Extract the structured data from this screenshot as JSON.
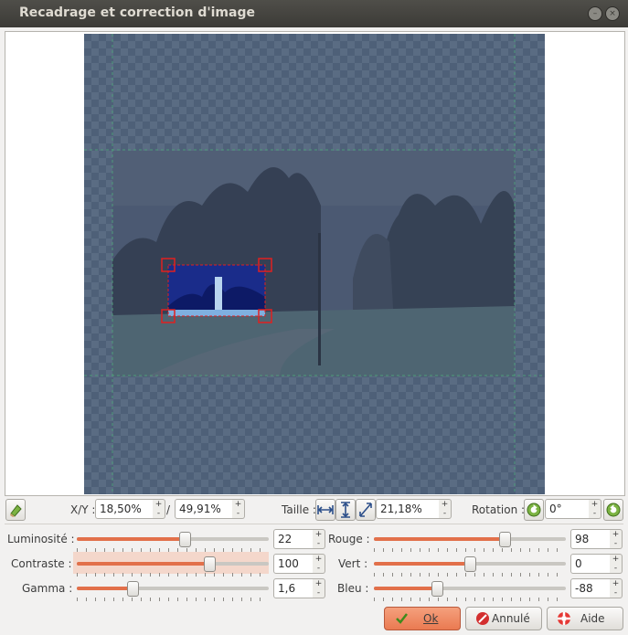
{
  "window": {
    "title": "Recadrage et correction d'image"
  },
  "toolbar": {
    "xy_label": "X/Y :",
    "x_value": "18,50%",
    "separator": "/",
    "y_value": "49,91%",
    "size_label": "Taille :",
    "size_value": "21,18%",
    "rotation_label": "Rotation :",
    "rotation_value": "0°"
  },
  "adjustments": {
    "brightness": {
      "label": "Luminosité :",
      "value": "22",
      "level": 0.56
    },
    "contrast": {
      "label": "Contraste :",
      "value": "100",
      "level": 0.69
    },
    "gamma": {
      "label": "Gamma :",
      "value": "1,6",
      "level": 0.29
    },
    "red": {
      "label": "Rouge :",
      "value": "98",
      "level": 0.68
    },
    "green": {
      "label": "Vert :",
      "value": "0",
      "level": 0.5
    },
    "blue": {
      "label": "Bleu :",
      "value": "-88",
      "level": 0.33
    }
  },
  "spin": {
    "up": "+",
    "down": "-"
  },
  "buttons": {
    "ok": "Ok",
    "cancel": "Annulé",
    "help": "Aide"
  },
  "colors": {
    "accent": "#ea7a51",
    "crop_handle": "#e02020",
    "guide": "#4f9a7a"
  }
}
